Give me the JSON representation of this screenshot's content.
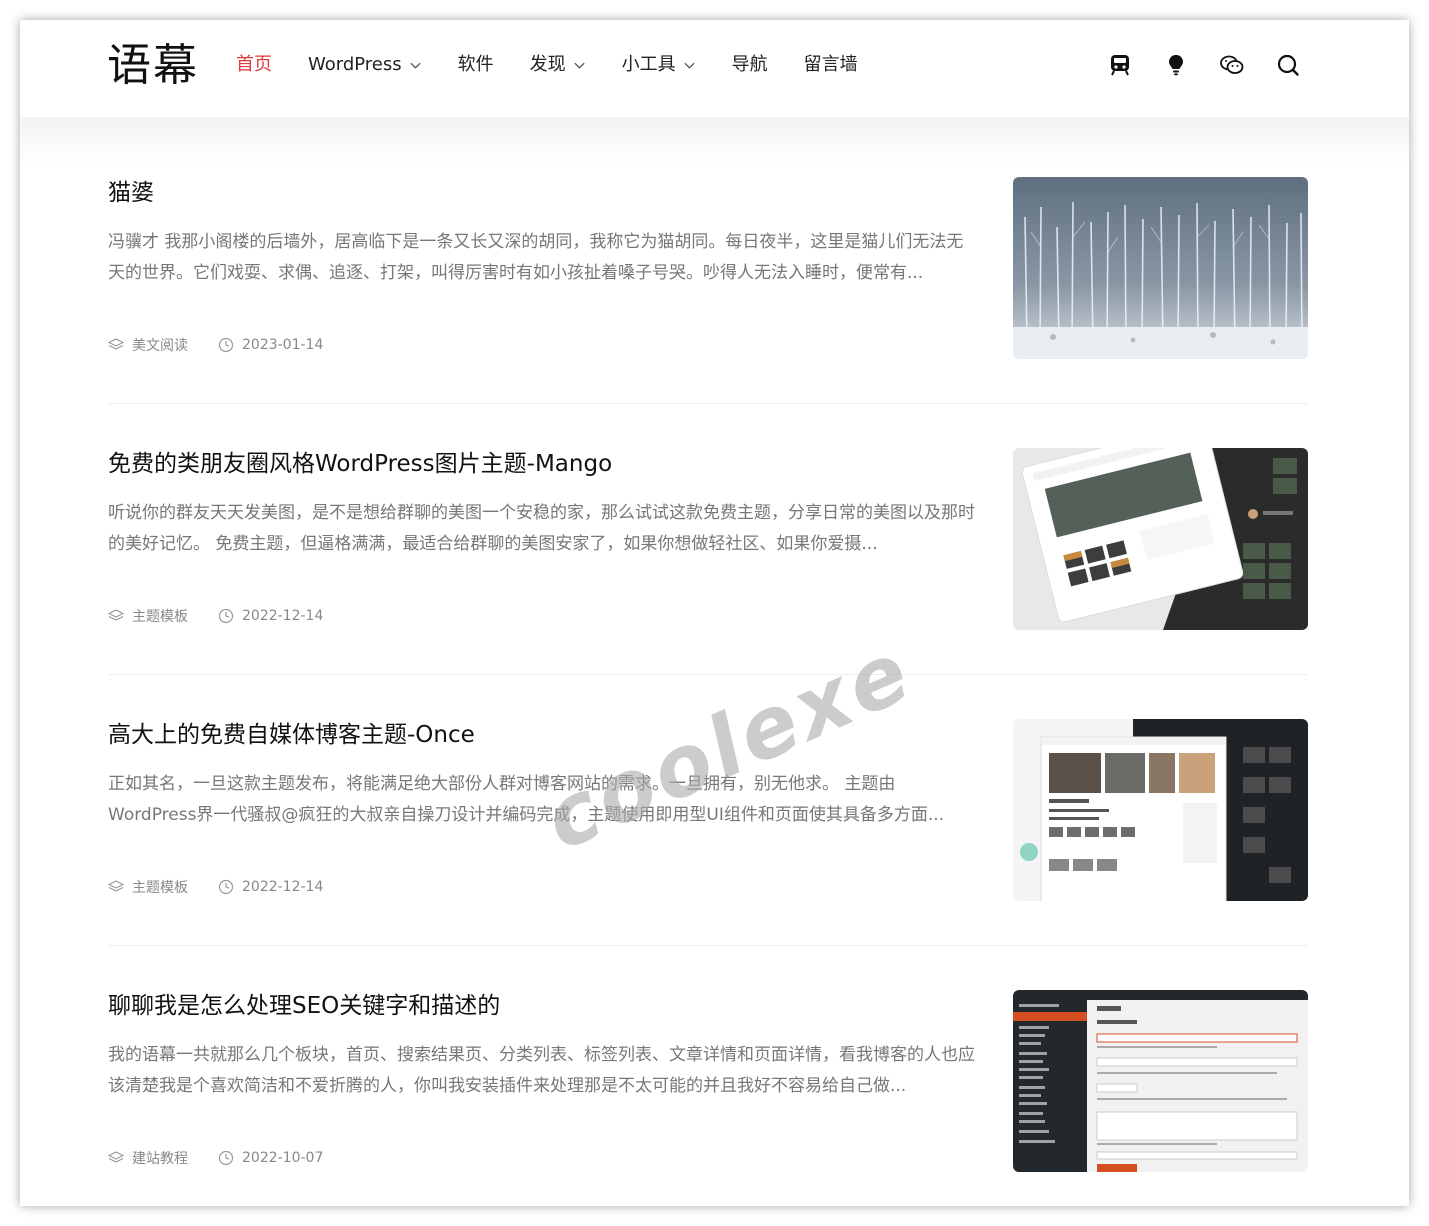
{
  "site": {
    "logo": "语幕"
  },
  "nav": {
    "items": [
      {
        "label": "首页",
        "active": true,
        "dropdown": false
      },
      {
        "label": "WordPress",
        "active": false,
        "dropdown": true
      },
      {
        "label": "软件",
        "active": false,
        "dropdown": false
      },
      {
        "label": "发现",
        "active": false,
        "dropdown": true
      },
      {
        "label": "小工具",
        "active": false,
        "dropdown": true
      },
      {
        "label": "导航",
        "active": false,
        "dropdown": false
      },
      {
        "label": "留言墙",
        "active": false,
        "dropdown": false
      }
    ],
    "icons": [
      "train-icon",
      "lightbulb-icon",
      "wechat-icon",
      "search-icon"
    ]
  },
  "posts": [
    {
      "title": "猫婆",
      "excerpt": "冯骥才 我那小阁楼的后墙外，居高临下是一条又长又深的胡同，我称它为猫胡同。每日夜半，这里是猫儿们无法无天的世界。它们戏耍、求偶、追逐、打架，叫得厉害时有如小孩扯着嗓子号哭。吵得人无法入睡时，便常有...",
      "category": "美文阅读",
      "date": "2023-01-14",
      "thumb": "snowy-forest"
    },
    {
      "title": "免费的类朋友圈风格WordPress图片主题-Mango",
      "excerpt": "听说你的群友天天发美图，是不是想给群聊的美图一个安稳的家，那么试试这款免费主题，分享日常的美图以及那时的美好记忆。 免费主题，但逼格满满，最适合给群聊的美图安家了，如果你想做轻社区、如果你爱摄...",
      "category": "主题模板",
      "date": "2022-12-14",
      "thumb": "mango-theme-screens"
    },
    {
      "title": "高大上的免费自媒体博客主题-Once",
      "excerpt": "正如其名，一旦这款主题发布，将能满足绝大部份人群对博客网站的需求。一旦拥有，别无他求。 主题由WordPress界一代骚叔@疯狂的大叔亲自操刀设计并编码完成，主题使用即用型UI组件和页面使其具备多方面...",
      "category": "主题模板",
      "date": "2022-12-14",
      "thumb": "once-theme-screens"
    },
    {
      "title": "聊聊我是怎么处理SEO关键字和描述的",
      "excerpt": "我的语幕一共就那么几个板块，首页、搜索结果页、分类列表、标签列表、文章详情和页面详情，看我博客的人也应该清楚我是个喜欢简洁和不爱折腾的人，你叫我安装插件来处理那是不太可能的并且我好不容易给自己做...",
      "category": "建站教程",
      "date": "2022-10-07",
      "thumb": "wp-admin-category"
    }
  ],
  "watermark": "coolexe",
  "colors": {
    "accent": "#e0393e",
    "text": "#222222",
    "excerpt": "#777777",
    "meta": "#888888"
  }
}
